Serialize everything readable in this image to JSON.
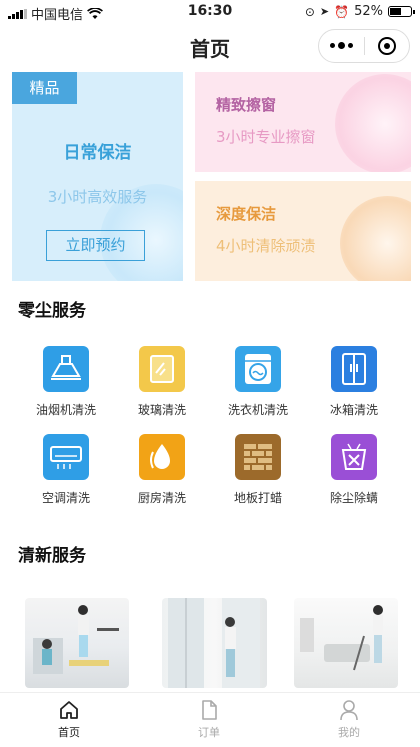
{
  "status_bar": {
    "carrier": "中国电信",
    "time": "16:30",
    "battery": "52%"
  },
  "nav": {
    "title": "首页"
  },
  "promo": {
    "main": {
      "tag": "精品",
      "title": "日常保洁",
      "subtitle": "3小时高效服务",
      "button": "立即预约"
    },
    "window": {
      "title": "精致擦窗",
      "subtitle": "3小时专业擦窗"
    },
    "deep": {
      "title": "深度保洁",
      "subtitle": "4小时清除顽渍"
    }
  },
  "services": {
    "title": "零尘服务",
    "items": [
      {
        "label": "油烟机清洗",
        "icon": "range-hood-icon",
        "color": "#2f9ee6"
      },
      {
        "label": "玻璃清洗",
        "icon": "glass-icon",
        "color": "#f3c84a"
      },
      {
        "label": "洗衣机清洗",
        "icon": "washing-machine-icon",
        "color": "#35a4e8"
      },
      {
        "label": "冰箱清洗",
        "icon": "fridge-icon",
        "color": "#2b7fe0"
      },
      {
        "label": "空调清洗",
        "icon": "air-conditioner-icon",
        "color": "#2f9ee6"
      },
      {
        "label": "厨房清洗",
        "icon": "kitchen-icon",
        "color": "#f2a316"
      },
      {
        "label": "地板打蜡",
        "icon": "floor-wax-icon",
        "color": "#9c6a2b"
      },
      {
        "label": "除尘除螨",
        "icon": "dust-mite-icon",
        "color": "#9a4fd6"
      }
    ]
  },
  "fresh": {
    "title": "清新服务"
  },
  "tabbar": {
    "items": [
      {
        "label": "首页",
        "icon": "home-icon"
      },
      {
        "label": "订单",
        "icon": "order-icon"
      },
      {
        "label": "我的",
        "icon": "profile-icon"
      }
    ]
  }
}
